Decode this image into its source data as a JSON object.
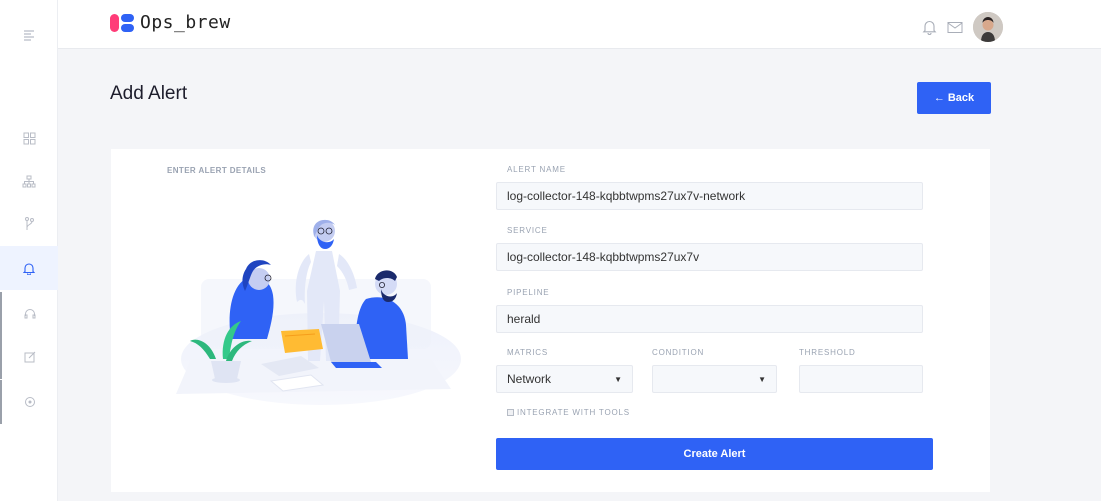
{
  "app": {
    "name": "Ops_brew"
  },
  "colors": {
    "accent": "#2f62f5",
    "logo_pink": "#ff3c78",
    "logo_blue": "#2f62f5"
  },
  "sidebar": {
    "items": [
      {
        "icon": "menu-icon"
      },
      {
        "icon": "dashboard-grid-icon"
      },
      {
        "icon": "hierarchy-icon"
      },
      {
        "icon": "branch-icon"
      },
      {
        "icon": "bell-icon",
        "active": true
      },
      {
        "icon": "headset-icon"
      },
      {
        "icon": "edit-icon"
      },
      {
        "icon": "target-icon"
      }
    ]
  },
  "topbar": {
    "icons": [
      "bell-icon",
      "mail-icon",
      "avatar"
    ]
  },
  "page": {
    "title": "Add Alert",
    "back_label": "Back"
  },
  "form": {
    "section_label": "ENTER ALERT DETAILS",
    "alert_name": {
      "label": "ALERT NAME",
      "value": "log-collector-148-kqbbtwpms27ux7v-network"
    },
    "service": {
      "label": "SERVICE",
      "value": "log-collector-148-kqbbtwpms27ux7v"
    },
    "pipeline": {
      "label": "PIPELINE",
      "value": "herald"
    },
    "matrics": {
      "label": "MATRICS",
      "value": "Network"
    },
    "condition": {
      "label": "CONDITION",
      "value": ""
    },
    "threshold": {
      "label": "THRESHOLD",
      "value": ""
    },
    "integrate_label": "INTEGRATE WITH TOOLS",
    "integrate_checked": false,
    "submit_label": "Create Alert"
  }
}
